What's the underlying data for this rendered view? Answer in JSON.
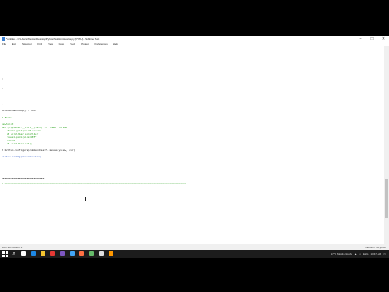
{
  "window": {
    "title": "*untitled - C:\\Users\\Weston\\Desktop\\Python\\Sublime\\tutorial.py (PYTH) - Sublime Text",
    "min": "–",
    "max": "□",
    "close": "✕"
  },
  "menu": [
    "File",
    "Edit",
    "Selection",
    "Find",
    "View",
    "Goto",
    "Tools",
    "Project",
    "Preferences",
    "Help"
  ],
  "code": {
    "l1": "{",
    "l2": "}",
    "l3": "}",
    "l4": "window.mainloop() - root",
    "l5": "# Frame",
    "l6": "newPoint",
    "l7": "def (Toplevel.__init__(self) -> Frame\".format",
    "l8": "    frame.grid(row=0 column",
    "l9": "    # Scrollbar scrollbar",
    "l10": "    label.pack(side=LEFT",
    "l11": "    col=0",
    "l12": "    # scrollbar.set()",
    "l13": "# button.configure(command=self.canvas.yview, cur)",
    "l14": "window.config(menu=menubar)",
    "l15": "#############################",
    "l16": "# ============================================================================================================================"
  },
  "status": {
    "left": "Line 38, Column 1",
    "right": "Tab Size: 4    Python"
  },
  "tray": {
    "weather": "17°C Mostly cloudy",
    "lang": "ENG",
    "time": "10:47 AM"
  }
}
